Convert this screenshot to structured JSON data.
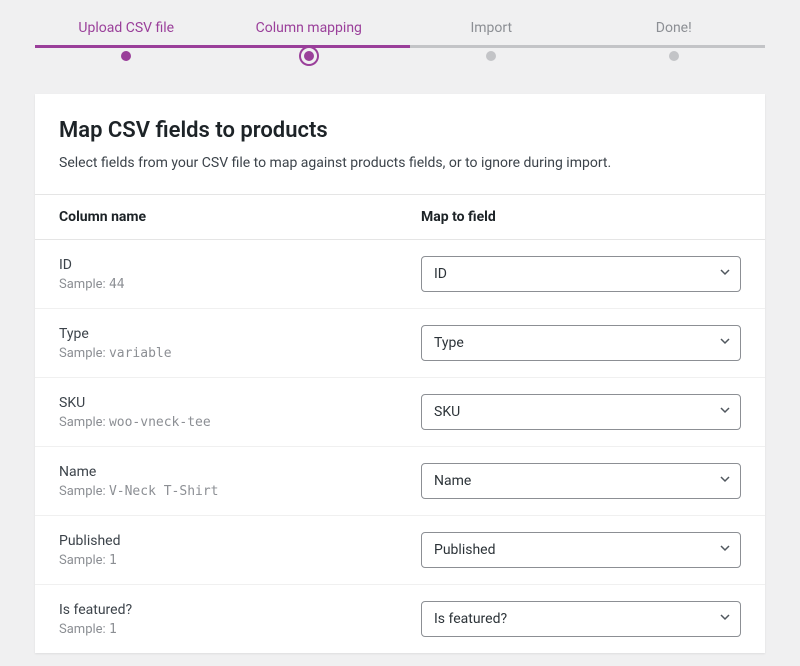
{
  "stepper": {
    "steps": [
      {
        "label": "Upload CSV file"
      },
      {
        "label": "Column mapping"
      },
      {
        "label": "Import"
      },
      {
        "label": "Done!"
      }
    ]
  },
  "panel": {
    "title": "Map CSV fields to products",
    "description": "Select fields from your CSV file to map against products fields, or to ignore during import."
  },
  "table": {
    "header_column": "Column name",
    "header_field": "Map to field",
    "sample_prefix": "Sample:",
    "rows": [
      {
        "name": "ID",
        "sample": "44",
        "field": "ID"
      },
      {
        "name": "Type",
        "sample": "variable",
        "field": "Type"
      },
      {
        "name": "SKU",
        "sample": "woo-vneck-tee",
        "field": "SKU"
      },
      {
        "name": "Name",
        "sample": "V-Neck T-Shirt",
        "field": "Name"
      },
      {
        "name": "Published",
        "sample": "1",
        "field": "Published"
      },
      {
        "name": "Is featured?",
        "sample": "1",
        "field": "Is featured?"
      }
    ]
  }
}
